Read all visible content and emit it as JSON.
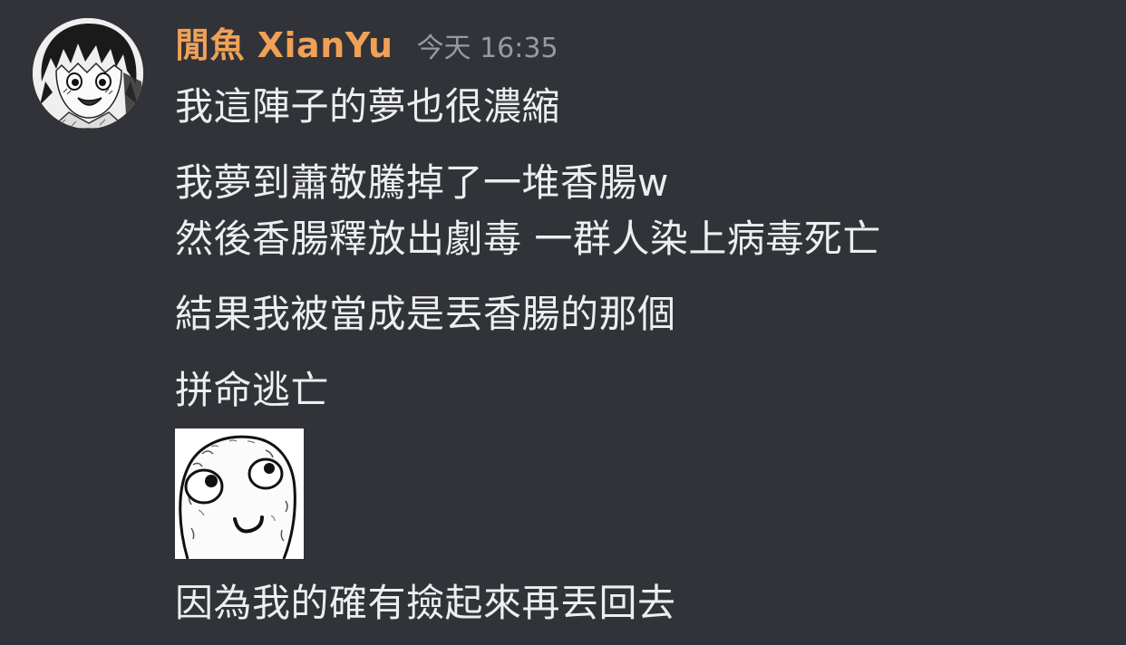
{
  "message": {
    "author": "閒魚 XianYu",
    "timestamp": "今天 16:35",
    "avatar_icon": "anime-boy-avatar",
    "author_color": "#f0a157",
    "lines": [
      "我這陣子的夢也很濃縮",
      "我夢到蕭敬騰掉了一堆香腸w",
      "然後香腸釋放出劇毒 一群人染上病毒死亡",
      "結果我被當成是丟香腸的那個",
      "拼命逃亡",
      "因為我的確有撿起來再丟回去"
    ],
    "embedded_image_icon": "derp-face-meme-icon"
  }
}
